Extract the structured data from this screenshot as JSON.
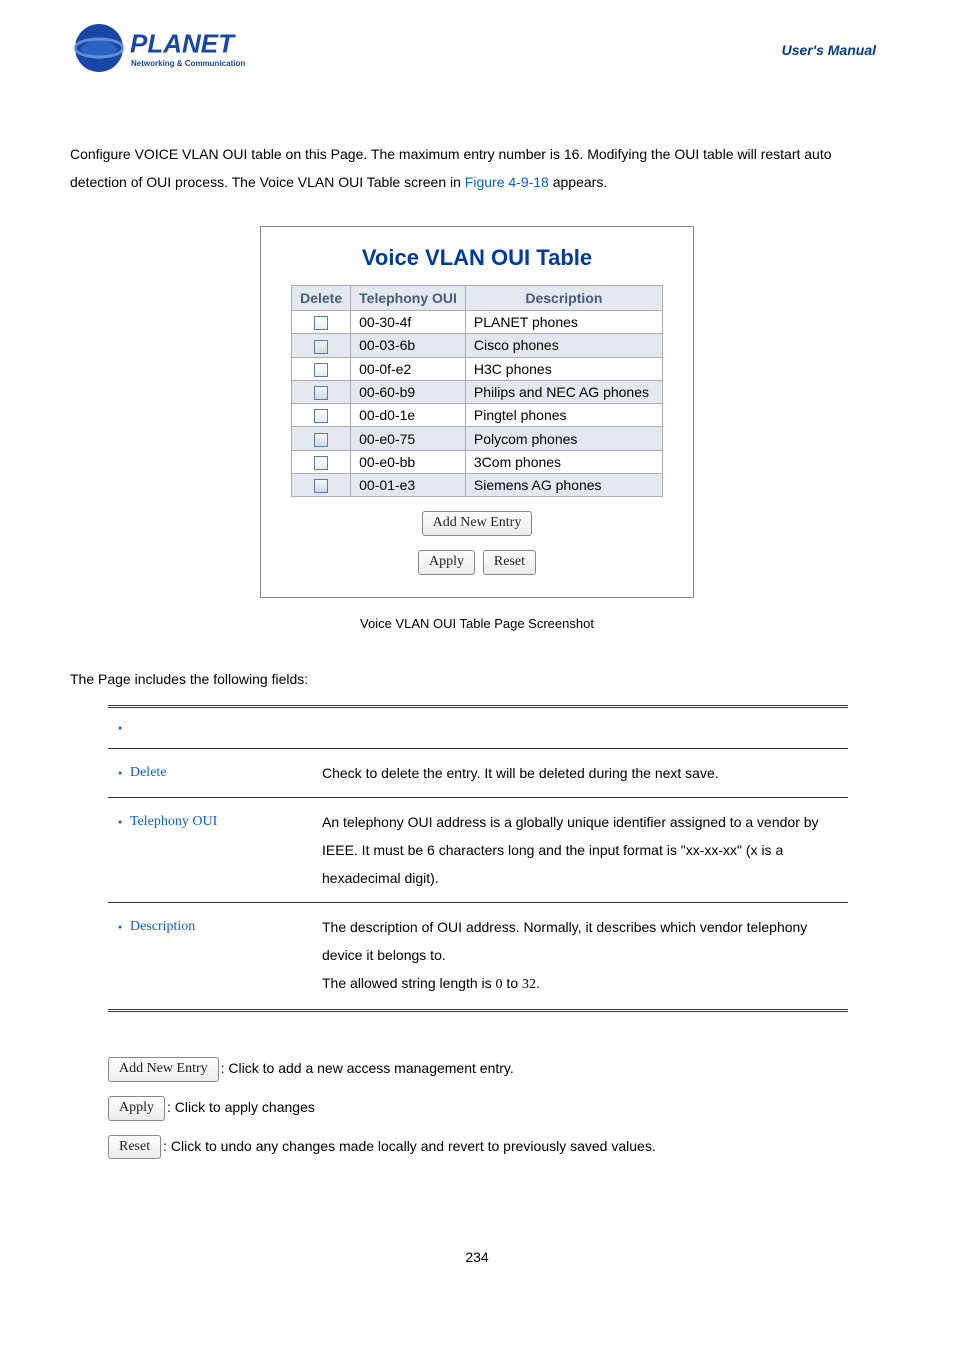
{
  "header": {
    "logo_alt": "PLANET Networking & Communication",
    "manual": "User's  Manual"
  },
  "intro": {
    "line1_a": "Configure VOICE VLAN OUI table on this Page. The maximum entry number is 16. Modifying the OUI table will restart auto ",
    "line2_a": "detection of OUI process. The Voice VLAN OUI Table screen in ",
    "figure_ref": "Figure 4-9-18",
    "line2_b": " appears."
  },
  "panel": {
    "title": "Voice VLAN OUI Table",
    "headers": {
      "delete": "Delete",
      "oui": "Telephony OUI",
      "desc": "Description"
    },
    "rows": [
      {
        "oui": "00-30-4f",
        "desc": "PLANET phones"
      },
      {
        "oui": "00-03-6b",
        "desc": "Cisco phones"
      },
      {
        "oui": "00-0f-e2",
        "desc": "H3C phones"
      },
      {
        "oui": "00-60-b9",
        "desc": "Philips and NEC AG phones"
      },
      {
        "oui": "00-d0-1e",
        "desc": "Pingtel phones"
      },
      {
        "oui": "00-e0-75",
        "desc": "Polycom phones"
      },
      {
        "oui": "00-e0-bb",
        "desc": "3Com phones"
      },
      {
        "oui": "00-01-e3",
        "desc": "Siemens AG phones"
      }
    ],
    "buttons": {
      "add": "Add New Entry",
      "apply": "Apply",
      "reset": "Reset"
    }
  },
  "caption": "Voice VLAN OUI Table Page Screenshot",
  "fields_intro": "The Page includes the following fields:",
  "fields": {
    "rows": [
      {
        "obj": "",
        "desc": ""
      },
      {
        "obj": "Delete",
        "desc": "Check to delete the entry. It will be deleted during the next save."
      },
      {
        "obj": "Telephony OUI",
        "desc": "An telephony OUI address is a globally unique identifier assigned to a vendor by IEEE. It must be 6 characters long and the input format is \"xx-xx-xx\" (x is a hexadecimal digit)."
      },
      {
        "obj": "Description",
        "desc_a": "The description of OUI address. Normally, it describes which vendor telephony device it belongs to.",
        "desc_b": "The allowed string length is ",
        "desc_c": "0",
        "desc_d": " to ",
        "desc_e": "32",
        "desc_f": "."
      }
    ]
  },
  "button_help": {
    "add": {
      "label": "Add New Entry",
      "desc": ": Click to add a new access management entry."
    },
    "apply": {
      "label": "Apply",
      "desc": ": Click to apply changes"
    },
    "reset": {
      "label": "Reset",
      "desc": ": Click to undo any changes made locally and revert to previously saved values."
    }
  },
  "page_number": "234"
}
